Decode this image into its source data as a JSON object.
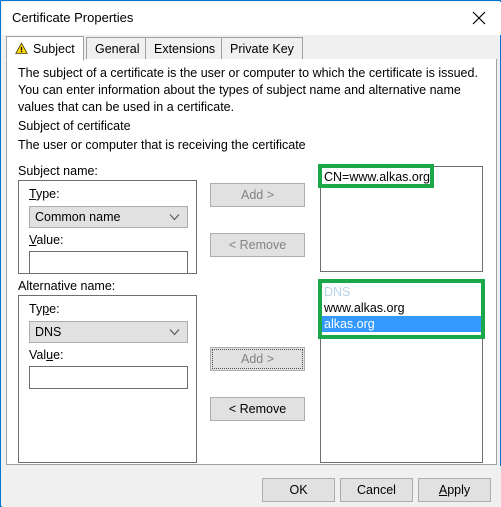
{
  "window": {
    "title": "Certificate Properties",
    "close_icon": "close-icon"
  },
  "tabs": [
    {
      "label": "Subject",
      "icon": "warning-triangle-icon",
      "active": true
    },
    {
      "label": "General",
      "active": false
    },
    {
      "label": "Extensions",
      "active": false
    },
    {
      "label": "Private Key",
      "active": false
    }
  ],
  "subject_tab": {
    "description": "The subject of a certificate is the user or computer to which the certificate is issued. You can enter information about the types of subject name and alternative name values that can be used in a certificate.",
    "section_heading": "Subject of certificate",
    "section_subtext": "The user or computer that is receiving the certificate",
    "subject_name": {
      "group_label": "Subject name:",
      "type_label": "Type:",
      "type_accel": "T",
      "type_value": "Common name",
      "type_caret_icon": "chevron-down-icon",
      "value_label": "Value:",
      "value_accel": "V",
      "value_text": "",
      "value_placeholder": "",
      "add_button": "Add >",
      "add_enabled": false,
      "remove_button": "< Remove",
      "remove_enabled": false,
      "list_items": [
        {
          "text": "CN=www.alkas.org",
          "state": "normal"
        }
      ]
    },
    "alternative_name": {
      "group_label": "Alternative name:",
      "type_label": "Type:",
      "type_accel": "p",
      "type_value": "DNS",
      "type_caret_icon": "chevron-down-icon",
      "value_label": "Value:",
      "value_accel": "u",
      "value_text": "",
      "value_placeholder": "",
      "add_button": "Add >",
      "add_enabled": false,
      "add_focused": true,
      "remove_button": "< Remove",
      "remove_enabled": true,
      "list_items": [
        {
          "text": "DNS",
          "state": "header"
        },
        {
          "text": "www.alkas.org",
          "state": "normal"
        },
        {
          "text": "alkas.org",
          "state": "selected"
        }
      ]
    }
  },
  "footer": {
    "ok": "OK",
    "cancel": "Cancel",
    "apply": "Apply",
    "apply_accel": "A"
  },
  "annotations": {
    "color": "#1aa84a",
    "boxes": [
      {
        "name": "subject-name-list-highlight"
      },
      {
        "name": "alternative-name-list-highlight"
      }
    ]
  }
}
